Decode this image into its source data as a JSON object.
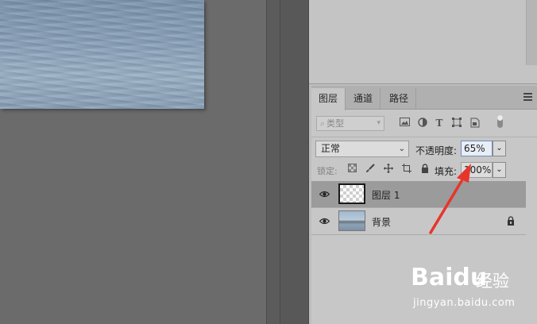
{
  "layers_panel": {
    "tabs": [
      {
        "label": "图层",
        "active": true
      },
      {
        "label": "通道",
        "active": false
      },
      {
        "label": "路径",
        "active": false
      }
    ],
    "filter": {
      "placeholder": "类型",
      "icons": [
        "image-filter-icon",
        "adjustment-filter-icon",
        "type-filter-icon",
        "shape-filter-icon",
        "smart-object-filter-icon",
        "filter-toggle"
      ]
    },
    "blend_mode": "正常",
    "opacity_label": "不透明度:",
    "opacity_value": "65%",
    "lock_label": "锁定:",
    "lock_icons": [
      "lock-transparency-icon",
      "lock-image-pixels-icon",
      "lock-position-icon",
      "lock-artboard-icon",
      "lock-all-icon"
    ],
    "fill_label": "填充:",
    "fill_value": "100%",
    "layers": [
      {
        "name": "图层 1",
        "visible": true,
        "selected": true,
        "thumbnail": "transparent"
      },
      {
        "name": "背景",
        "visible": true,
        "selected": false,
        "thumbnail": "photo",
        "locked": true
      }
    ]
  },
  "watermark": {
    "brand": "Baidu",
    "sub": "经验",
    "url": "jingyan.baidu.com"
  },
  "colors": {
    "annotation_arrow": "#e8352b",
    "canvas_bg": "#6b6b6b",
    "panel_bg": "#c7c7c7",
    "selected_row": "#9b9b9b"
  }
}
